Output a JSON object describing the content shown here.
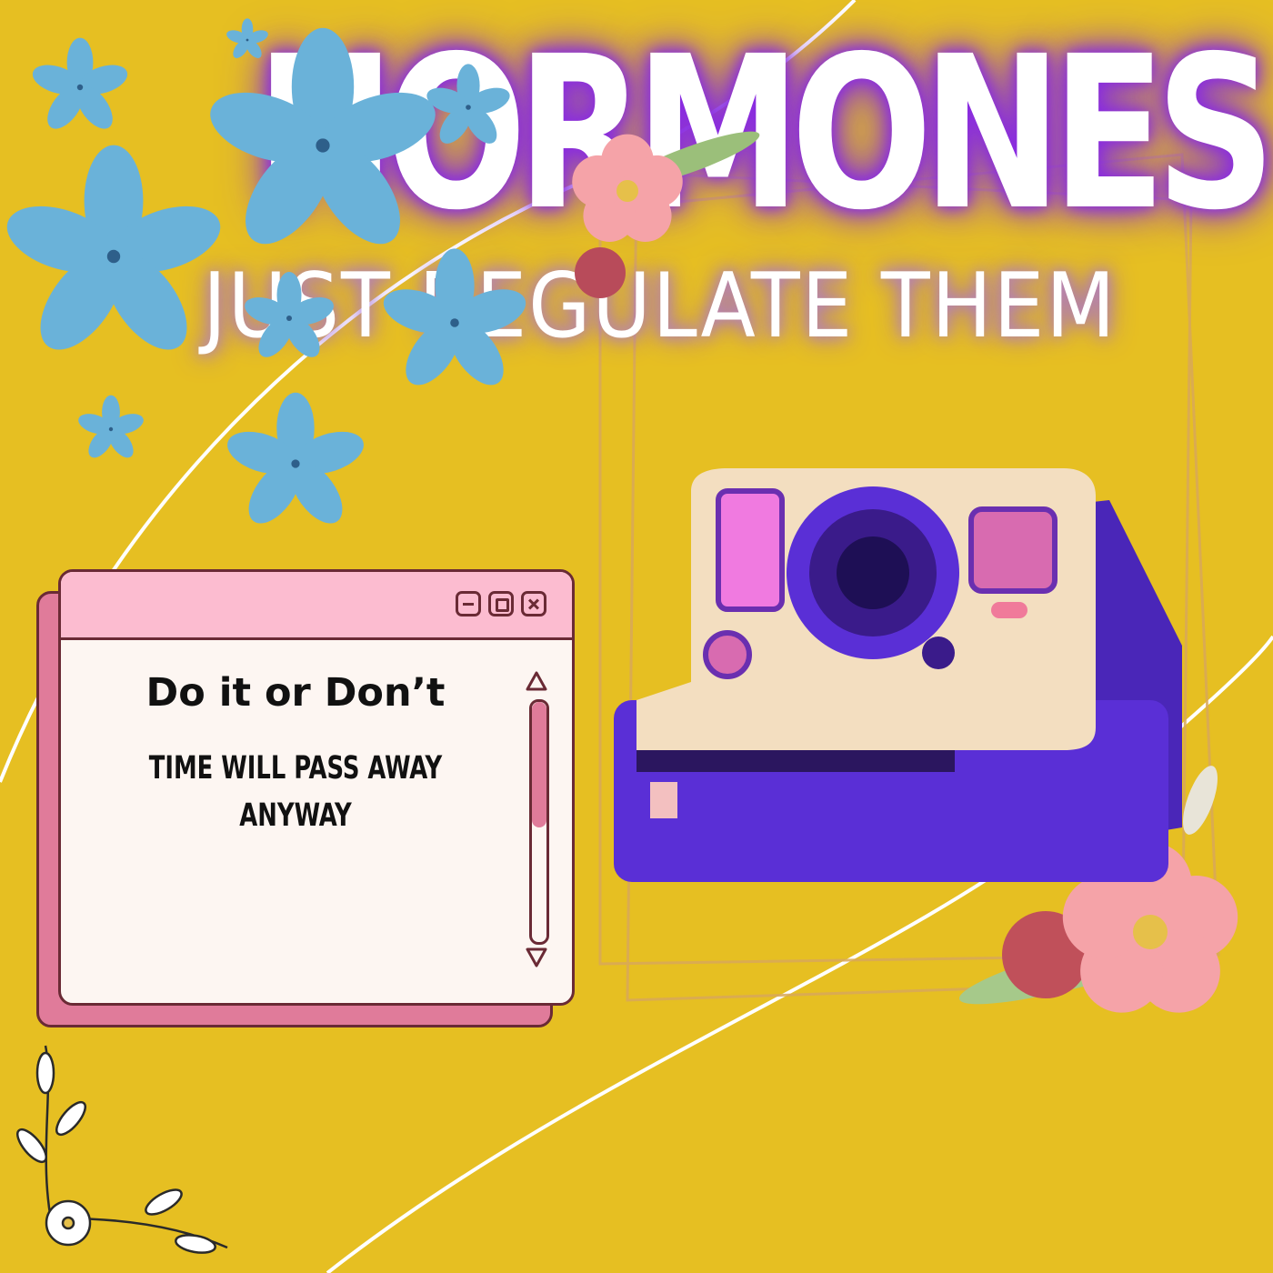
{
  "headline": "HORMONES",
  "subline": "JUST REGULATE THEM",
  "window": {
    "heading": "Do it or Don’t",
    "body": "Time will pass away anyway",
    "controls": {
      "minimize": "minimize-icon",
      "maximize": "maximize-icon",
      "close": "close-icon"
    },
    "scroll_position": 0.4
  },
  "colors": {
    "background": "#e6bf22",
    "window_fill": "#fdf6f2",
    "window_titlebar": "#fcbcd0",
    "window_shadow": "#e07b9a",
    "outline": "#6a2a35",
    "headline_glow": "#8a2be2",
    "flower_blue": "#6ab2d9",
    "camera_body": "#5a2fd6",
    "camera_face": "#f3dec0"
  },
  "decorations": [
    "blue-flower-icon",
    "pink-flower-icon",
    "camera-icon",
    "gold-frame",
    "white-swoosh-line",
    "white-flower-sprig-icon"
  ]
}
